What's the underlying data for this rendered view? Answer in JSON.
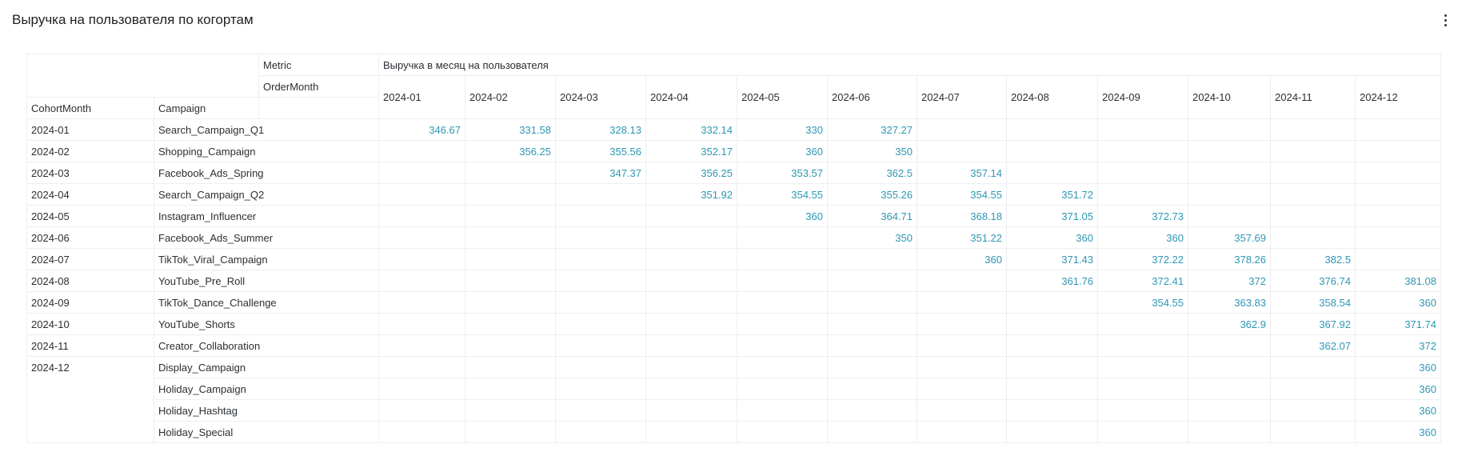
{
  "panel": {
    "title": "Выручка на пользователя по когортам"
  },
  "table": {
    "metric_label": "Metric",
    "metric_value": "Выручка в месяц на пользователя",
    "ordermonth_label": "OrderMonth",
    "cohort_label": "CohortMonth",
    "campaign_label": "Campaign",
    "months": [
      "2024-01",
      "2024-02",
      "2024-03",
      "2024-04",
      "2024-05",
      "2024-06",
      "2024-07",
      "2024-08",
      "2024-09",
      "2024-10",
      "2024-11",
      "2024-12"
    ],
    "rows": [
      {
        "cohort": "2024-01",
        "campaign": "Search_Campaign_Q1",
        "values": [
          "346.67",
          "331.58",
          "328.13",
          "332.14",
          "330",
          "327.27",
          "",
          "",
          "",
          "",
          "",
          ""
        ]
      },
      {
        "cohort": "2024-02",
        "campaign": "Shopping_Campaign",
        "values": [
          "",
          "356.25",
          "355.56",
          "352.17",
          "360",
          "350",
          "",
          "",
          "",
          "",
          "",
          ""
        ]
      },
      {
        "cohort": "2024-03",
        "campaign": "Facebook_Ads_Spring",
        "values": [
          "",
          "",
          "347.37",
          "356.25",
          "353.57",
          "362.5",
          "357.14",
          "",
          "",
          "",
          "",
          ""
        ]
      },
      {
        "cohort": "2024-04",
        "campaign": "Search_Campaign_Q2",
        "values": [
          "",
          "",
          "",
          "351.92",
          "354.55",
          "355.26",
          "354.55",
          "351.72",
          "",
          "",
          "",
          ""
        ]
      },
      {
        "cohort": "2024-05",
        "campaign": "Instagram_Influencer",
        "values": [
          "",
          "",
          "",
          "",
          "360",
          "364.71",
          "368.18",
          "371.05",
          "372.73",
          "",
          "",
          ""
        ]
      },
      {
        "cohort": "2024-06",
        "campaign": "Facebook_Ads_Summer",
        "values": [
          "",
          "",
          "",
          "",
          "",
          "350",
          "351.22",
          "360",
          "360",
          "357.69",
          "",
          ""
        ]
      },
      {
        "cohort": "2024-07",
        "campaign": "TikTok_Viral_Campaign",
        "values": [
          "",
          "",
          "",
          "",
          "",
          "",
          "360",
          "371.43",
          "372.22",
          "378.26",
          "382.5",
          ""
        ]
      },
      {
        "cohort": "2024-08",
        "campaign": "YouTube_Pre_Roll",
        "values": [
          "",
          "",
          "",
          "",
          "",
          "",
          "",
          "361.76",
          "372.41",
          "372",
          "376.74",
          "381.08"
        ]
      },
      {
        "cohort": "2024-09",
        "campaign": "TikTok_Dance_Challenge",
        "values": [
          "",
          "",
          "",
          "",
          "",
          "",
          "",
          "",
          "354.55",
          "363.83",
          "358.54",
          "360"
        ]
      },
      {
        "cohort": "2024-10",
        "campaign": "YouTube_Shorts",
        "values": [
          "",
          "",
          "",
          "",
          "",
          "",
          "",
          "",
          "",
          "362.9",
          "367.92",
          "371.74"
        ]
      },
      {
        "cohort": "2024-11",
        "campaign": "Creator_Collaboration",
        "values": [
          "",
          "",
          "",
          "",
          "",
          "",
          "",
          "",
          "",
          "",
          "362.07",
          "372"
        ]
      },
      {
        "cohort": "2024-12",
        "campaign": "Display_Campaign",
        "values": [
          "",
          "",
          "",
          "",
          "",
          "",
          "",
          "",
          "",
          "",
          "",
          "360"
        ]
      },
      {
        "cohort": "",
        "campaign": "Holiday_Campaign",
        "values": [
          "",
          "",
          "",
          "",
          "",
          "",
          "",
          "",
          "",
          "",
          "",
          "360"
        ]
      },
      {
        "cohort": "",
        "campaign": "Holiday_Hashtag",
        "values": [
          "",
          "",
          "",
          "",
          "",
          "",
          "",
          "",
          "",
          "",
          "",
          "360"
        ]
      },
      {
        "cohort": "",
        "campaign": "Holiday_Special",
        "values": [
          "",
          "",
          "",
          "",
          "",
          "",
          "",
          "",
          "",
          "",
          "",
          "360"
        ]
      }
    ]
  }
}
